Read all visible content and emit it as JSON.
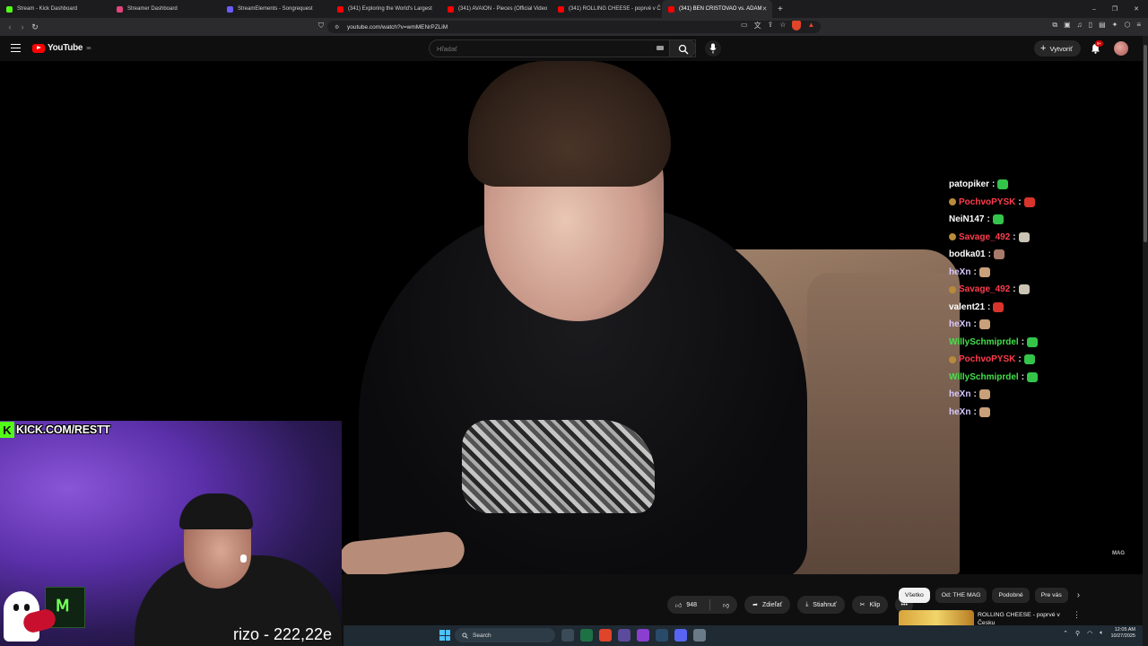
{
  "browser": {
    "tabs": [
      {
        "label": "Stream - Kick Dashboard",
        "color": "#53fc18"
      },
      {
        "label": "Streamer Dashboard",
        "color": "#e0457b"
      },
      {
        "label": "StreamElements - Songrequest",
        "color": "#6a5cff"
      },
      {
        "label": "(341) Exploring the World's Largest",
        "color": "#ff0000"
      },
      {
        "label": "(341) AVAION - Pieces (Official Video",
        "color": "#ff0000"
      },
      {
        "label": "(341) ROLLING CHEESE - poprvé v Č",
        "color": "#ff0000"
      },
      {
        "label": "(341) BEN CRISTOVAO vs. ADAM",
        "color": "#ff0000",
        "active": true
      }
    ],
    "new_tab": "+",
    "window_controls": [
      "–",
      "❐",
      "✕"
    ],
    "url": "youtube.com/watch?v=wmMENrPZLiM"
  },
  "youtube": {
    "logo_text": "YouTube",
    "region": "SK",
    "search_placeholder": "Hľadať",
    "create_label": "Vytvoriť",
    "notifications": "9+"
  },
  "video": {
    "watermark": "MAG"
  },
  "chat": [
    {
      "user": "patopiker",
      "color": "white",
      "badge": false,
      "emote": "#35c44a"
    },
    {
      "user": "PochvoPYSK",
      "color": "red",
      "badge": true,
      "emote": "#d8342c"
    },
    {
      "user": "NeiN147",
      "color": "white",
      "badge": false,
      "emote": "#35c44a"
    },
    {
      "user": "Savage_492",
      "color": "red",
      "badge": true,
      "emote": "#c9c4b4"
    },
    {
      "user": "bodka01",
      "color": "white",
      "badge": false,
      "emote": "#a87a6a"
    },
    {
      "user": "heXn",
      "color": "lilac",
      "badge": false,
      "emote": "#c8a07a"
    },
    {
      "user": "Savage_492",
      "color": "red",
      "badge": true,
      "emote": "#c9c4b4"
    },
    {
      "user": "valent21",
      "color": "white",
      "badge": false,
      "emote": "#d8342c"
    },
    {
      "user": "heXn",
      "color": "lilac",
      "badge": false,
      "emote": "#c8a07a"
    },
    {
      "user": "WillySchmiprdel",
      "color": "green",
      "badge": false,
      "emote": "#35c44a"
    },
    {
      "user": "PochvoPYSK",
      "color": "red",
      "badge": true,
      "emote": "#35c44a"
    },
    {
      "user": "WillySchmiprdel",
      "color": "green",
      "badge": false,
      "emote": "#35c44a"
    },
    {
      "user": "heXn",
      "color": "lilac",
      "badge": false,
      "emote": "#c8a07a"
    },
    {
      "user": "heXn",
      "color": "lilac",
      "badge": false,
      "emote": "#c8a07a"
    }
  ],
  "stream_overlay": {
    "kick_url": "KICK.COM/RESTT",
    "counter_text": "rizo - 222,22e"
  },
  "actions": {
    "likes": "948",
    "share": "Zdieľať",
    "download": "Stiahnuť",
    "clip": "Klip",
    "more": "•••"
  },
  "chips": [
    "Všetko",
    "Od: THE MAG",
    "Podobné",
    "Pre vás"
  ],
  "recommendation": {
    "title": "ROLLING CHEESE - poprvé v Česku"
  },
  "taskbar": {
    "search_placeholder": "Search",
    "time": "12:05 AM",
    "date": "10/27/2025"
  }
}
